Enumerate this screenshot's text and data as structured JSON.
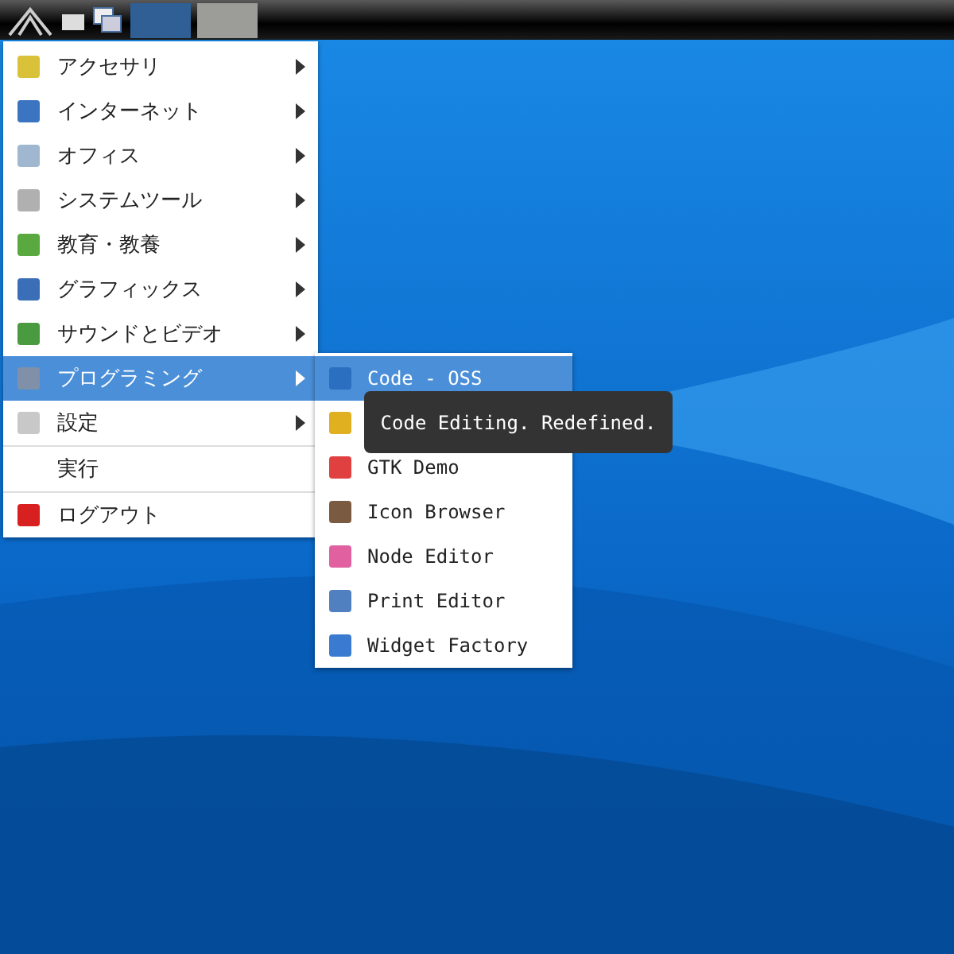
{
  "panel": {
    "tasks": [
      {
        "selected": true
      },
      {
        "selected": false
      }
    ]
  },
  "menu": {
    "items": [
      {
        "label": "アクセサリ",
        "submenu": true,
        "selected": false
      },
      {
        "label": "インターネット",
        "submenu": true,
        "selected": false
      },
      {
        "label": "オフィス",
        "submenu": true,
        "selected": false
      },
      {
        "label": "システムツール",
        "submenu": true,
        "selected": false
      },
      {
        "label": "教育・教養",
        "submenu": true,
        "selected": false
      },
      {
        "label": "グラフィックス",
        "submenu": true,
        "selected": false
      },
      {
        "label": "サウンドとビデオ",
        "submenu": true,
        "selected": false
      },
      {
        "label": "プログラミング",
        "submenu": true,
        "selected": true
      },
      {
        "label": "設定",
        "submenu": true,
        "selected": false
      },
      {
        "label": "実行",
        "submenu": false,
        "selected": false
      },
      {
        "label": "ログアウト",
        "submenu": false,
        "selected": false
      }
    ]
  },
  "submenu": {
    "items": [
      {
        "label": "Code - OSS",
        "selected": true
      },
      {
        "selected": false
      },
      {
        "label": "GTK Demo",
        "selected": false
      },
      {
        "label": "Icon Browser",
        "selected": false
      },
      {
        "label": "Node Editor",
        "selected": false
      },
      {
        "label": "Print Editor",
        "selected": false
      },
      {
        "label": "Widget Factory",
        "selected": false
      }
    ]
  },
  "tooltip": {
    "text": "Code Editing. Redefined."
  }
}
